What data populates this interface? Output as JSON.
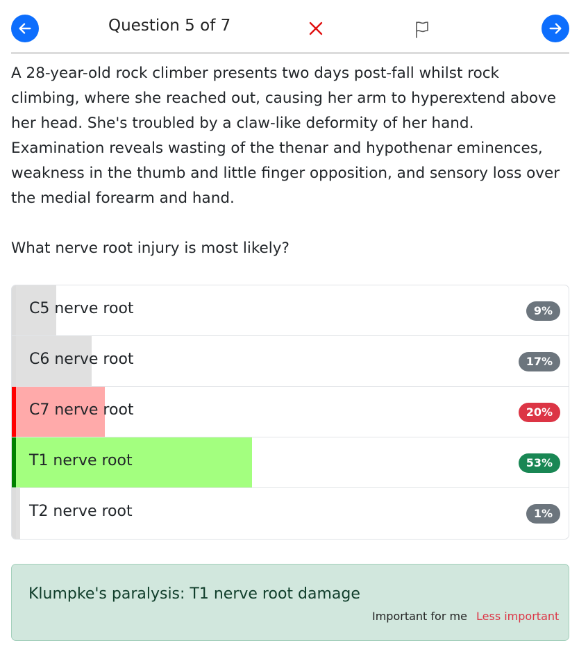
{
  "header": {
    "question_counter": "Question 5 of 7",
    "prev_icon": "arrow-left-icon",
    "next_icon": "arrow-right-icon",
    "close_icon": "close-icon",
    "flag_icon": "flag-icon"
  },
  "question": {
    "stem": "A 28-year-old rock climber presents two days post-fall whilst rock climbing, where she reached out, causing her arm to hyperextend above her head. She's troubled by a claw-like deformity of her hand. Examination reveals wasting of the thenar and hypothenar eminences, weakness in the thumb and little finger opposition, and sensory loss over the medial forearm and hand.",
    "ask": "What nerve root injury is most likely?"
  },
  "options": [
    {
      "label": "C5 nerve root",
      "percent_label": "9%",
      "percent": 9,
      "status": "neutral"
    },
    {
      "label": "C6 nerve root",
      "percent_label": "17%",
      "percent": 17,
      "status": "neutral"
    },
    {
      "label": "C7 nerve root",
      "percent_label": "20%",
      "percent": 20,
      "status": "selected-wrong"
    },
    {
      "label": "T1 nerve root",
      "percent_label": "53%",
      "percent": 53,
      "status": "correct"
    },
    {
      "label": "T2 nerve root",
      "percent_label": "1%",
      "percent": 1,
      "status": "neutral"
    }
  ],
  "colors": {
    "primary": "#0d6efd",
    "wrong_accent": "#ff0000",
    "wrong_fill": "#ffaaaa",
    "wrong_badge": "#dc3545",
    "correct_accent": "#008000",
    "correct_fill": "#a3ff7f",
    "correct_badge": "#198754",
    "neutral_accent": "#dcdcdc",
    "neutral_fill": "#e0e0e0",
    "neutral_badge": "#6c757d"
  },
  "feedback": {
    "explanation": "Klumpke's paralysis: T1 nerve root damage",
    "important_label": "Important for me",
    "less_important_label": "Less important"
  }
}
